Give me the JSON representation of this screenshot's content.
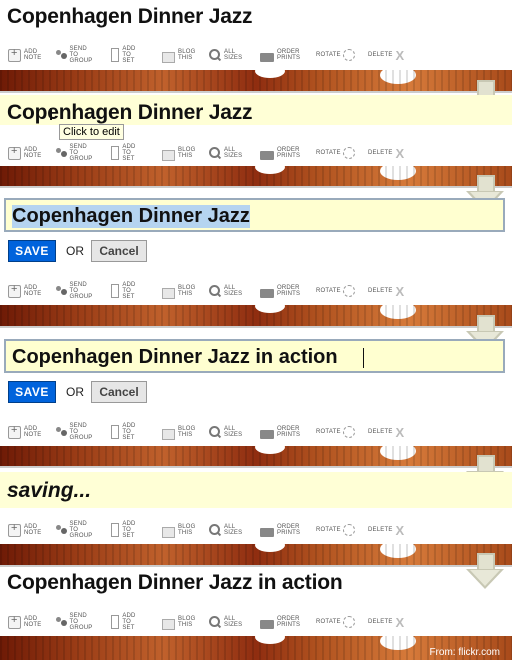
{
  "toolbar": {
    "add_note": [
      "ADD",
      "NOTE"
    ],
    "send_to_group": [
      "SEND TO",
      "GROUP"
    ],
    "add_to_set": [
      "ADD",
      "TO SET"
    ],
    "blog_this": [
      "BLOG",
      "THIS"
    ],
    "all_sizes": [
      "ALL",
      "SIZES"
    ],
    "order_prints": [
      "ORDER",
      "PRINTS"
    ],
    "rotate": "ROTATE",
    "delete": "DELETE",
    "delete_x": "X"
  },
  "frame1": {
    "title": "Copenhagen Dinner Jazz"
  },
  "frame2": {
    "title": "Copenhagen Dinner Jazz",
    "tooltip": "Click to edit"
  },
  "frame3": {
    "input_value": "Copenhagen Dinner Jazz",
    "save": "SAVE",
    "or": "OR",
    "cancel": "Cancel"
  },
  "frame4": {
    "input_value": "Copenhagen Dinner Jazz in action",
    "save": "SAVE",
    "or": "OR",
    "cancel": "Cancel"
  },
  "frame5": {
    "status": "saving..."
  },
  "frame6": {
    "title": "Copenhagen Dinner Jazz in action"
  },
  "credit": "From: flickr.com"
}
